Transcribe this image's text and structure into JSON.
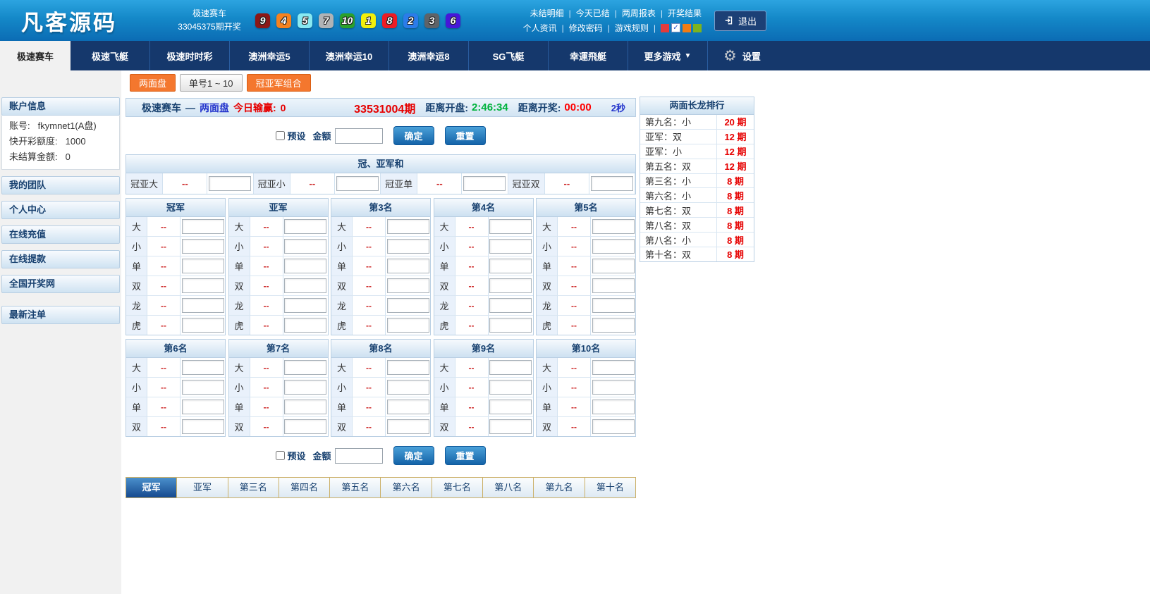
{
  "header": {
    "logo": "凡客源码",
    "draw": {
      "game": "极速赛车",
      "issue_label": "33045375期开奖"
    },
    "balls": [
      {
        "n": "9",
        "color": "#8c1717"
      },
      {
        "n": "4",
        "color": "#f5821f"
      },
      {
        "n": "5",
        "color": "#87e9f2"
      },
      {
        "n": "7",
        "color": "#b0b3b6"
      },
      {
        "n": "10",
        "color": "#2ba12b"
      },
      {
        "n": "1",
        "color": "#f2ef0c"
      },
      {
        "n": "8",
        "color": "#ed1c24"
      },
      {
        "n": "2",
        "color": "#2b7ce9"
      },
      {
        "n": "3",
        "color": "#5e6368"
      },
      {
        "n": "6",
        "color": "#4617d8"
      }
    ],
    "link_separator": "|",
    "links_row1": [
      "未结明细",
      "今天已结",
      "两周报表",
      "开奖结果"
    ],
    "links_row2": [
      "个人资讯",
      "修改密码",
      "游戏规则"
    ],
    "indicator_squares": [
      {
        "type": "square",
        "color": "#e23b3b"
      },
      {
        "type": "checkbox",
        "checked": true
      },
      {
        "type": "square",
        "color": "#f07c14"
      },
      {
        "type": "square",
        "color": "#7cb31f"
      }
    ],
    "check_glyph": "✓",
    "logout_label": "退出"
  },
  "nav": {
    "tabs": [
      {
        "label": "极速赛车",
        "active": true
      },
      {
        "label": "极速飞艇"
      },
      {
        "label": "极速时时彩"
      },
      {
        "label": "澳洲幸运5"
      },
      {
        "label": "澳洲幸运10"
      },
      {
        "label": "澳洲幸运8"
      },
      {
        "label": "SG飞艇"
      },
      {
        "label": "幸運飛艇"
      },
      {
        "label": "更多游戏",
        "dropdown": true
      }
    ],
    "dropdown_glyph": "▼",
    "settings_label": "设置"
  },
  "sidebar": {
    "account": {
      "title": "账户信息",
      "fields": [
        {
          "label": "账号:",
          "value": "fkymnet1(A盘)"
        },
        {
          "label": "快开彩额度:",
          "value": "1000"
        },
        {
          "label": "未结算金额:",
          "value": "0"
        }
      ]
    },
    "menu": [
      "我的团队",
      "个人中心",
      "在线充值",
      "在线提款",
      "全国开奖网",
      "最新注单"
    ]
  },
  "main": {
    "modes": [
      {
        "label": "两面盘",
        "style": "orange",
        "active": true
      },
      {
        "label": "单号1 ~ 10",
        "style": "gray",
        "active": false
      },
      {
        "label": "冠亚军组合",
        "style": "orange",
        "active": false
      }
    ],
    "info_bar": {
      "game": "极速赛车",
      "dash": "—",
      "mode": "两面盘",
      "win_label": "今日输赢:",
      "win_value": "0",
      "issue": "33531004期",
      "open_label": "距离开盘:",
      "open_time": "2:46:34",
      "close_label": "距离开奖:",
      "close_time": "00:00",
      "seconds": "2秒"
    },
    "preset": {
      "label": "预设",
      "amount_label": "金额",
      "amount_value": "",
      "confirm": "确定",
      "reset": "重置"
    },
    "sum_section": {
      "title": "冠、亚军和",
      "cells": [
        {
          "label": "冠亚大",
          "odds": "--"
        },
        {
          "label": "冠亚小",
          "odds": "--"
        },
        {
          "label": "冠亚单",
          "odds": "--"
        },
        {
          "label": "冠亚双",
          "odds": "--"
        }
      ]
    },
    "bet_tables": [
      {
        "columns": [
          "冠军",
          "亚军",
          "第3名",
          "第4名",
          "第5名"
        ],
        "rows": [
          "大",
          "小",
          "单",
          "双",
          "龙",
          "虎"
        ],
        "odds": "--"
      },
      {
        "columns": [
          "第6名",
          "第7名",
          "第8名",
          "第9名",
          "第10名"
        ],
        "rows": [
          "大",
          "小",
          "单",
          "双"
        ],
        "odds": "--"
      }
    ],
    "bottom_tabs": [
      {
        "label": "冠军",
        "active": true
      },
      {
        "label": "亚军",
        "active": false
      },
      {
        "label": "第三名",
        "active": false
      },
      {
        "label": "第四名",
        "active": false
      },
      {
        "label": "第五名",
        "active": false
      },
      {
        "label": "第六名",
        "active": false
      },
      {
        "label": "第七名",
        "active": false
      },
      {
        "label": "第八名",
        "active": false
      },
      {
        "label": "第九名",
        "active": false
      },
      {
        "label": "第十名",
        "active": false
      }
    ]
  },
  "rank_panel": {
    "title": "两面长龙排行",
    "unit": "期",
    "rows": [
      {
        "name": "第九名：小",
        "count": "20"
      },
      {
        "name": "亚军：双",
        "count": "12"
      },
      {
        "name": "亚军：小",
        "count": "12"
      },
      {
        "name": "第五名：双",
        "count": "12"
      },
      {
        "name": "第三名：小",
        "count": "8"
      },
      {
        "name": "第六名：小",
        "count": "8"
      },
      {
        "name": "第七名：双",
        "count": "8"
      },
      {
        "name": "第八名：双",
        "count": "8"
      },
      {
        "name": "第八名：小",
        "count": "8"
      },
      {
        "name": "第十名：双",
        "count": "8"
      }
    ]
  },
  "colors": {
    "accent_orange": "#f4772e",
    "button_blue": "#1463a8",
    "odds_red": "#cc2222",
    "win_green": "#00b33c",
    "timer_red": "#ff0000",
    "link_blue": "#2233cc",
    "nav_navy": "#15386c"
  }
}
